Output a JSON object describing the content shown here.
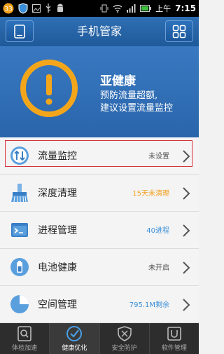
{
  "status_bar": {
    "notification_badge": "33",
    "ampm": "上午",
    "time": "7:15"
  },
  "header": {
    "title": "手机管家"
  },
  "banner": {
    "title": "亚健康",
    "line1": "预防流量超额,",
    "line2": "建议设置流量监控",
    "accent_color": "#f4a61b"
  },
  "items": [
    {
      "label": "流量监控",
      "status": "未设置",
      "status_color": "#555555",
      "icon": "traffic-icon"
    },
    {
      "label": "深度清理",
      "status": "15天未清理",
      "status_color": "#f0a020",
      "icon": "broom-icon"
    },
    {
      "label": "进程管理",
      "status": "40进程",
      "status_color": "#3a8fd8",
      "icon": "process-icon"
    },
    {
      "label": "电池健康",
      "status": "未开启",
      "status_color": "#555555",
      "icon": "battery-icon"
    },
    {
      "label": "空间管理",
      "status": "795.1M剩余",
      "status_color": "#3a8fd8",
      "icon": "storage-icon"
    }
  ],
  "tabs": [
    {
      "label": "体检加速",
      "icon": "magnifier-icon"
    },
    {
      "label": "健康优化",
      "icon": "checkmark-icon",
      "active": true
    },
    {
      "label": "安全防护",
      "icon": "shield-icon"
    },
    {
      "label": "软件管理",
      "icon": "software-icon"
    }
  ]
}
